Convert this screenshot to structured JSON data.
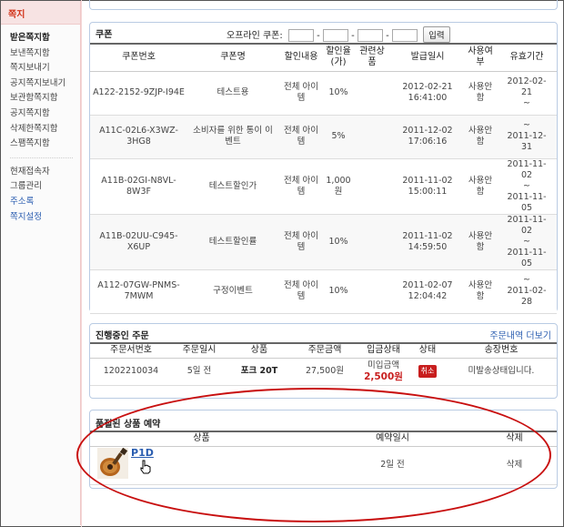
{
  "sidebar": {
    "title": "쪽지",
    "group1": [
      "받은쪽지함",
      "보낸쪽지함",
      "쪽지보내기",
      "공지쪽지보내기",
      "보관함쪽지함",
      "공지쪽지함",
      "삭제한쪽지함",
      "스팸쪽지함"
    ],
    "group2": [
      "현재접속자",
      "그룹관리",
      "주소록",
      "쪽지설정"
    ]
  },
  "coupon": {
    "title": "쿠폰",
    "offline_label": "오프라인 쿠폰:",
    "dash": "-",
    "input_button": "입력",
    "headers": [
      "쿠폰번호",
      "쿠폰명",
      "할인내용",
      "할인율\n(가)",
      "관련상\n품",
      "발급일시",
      "사용여\n부",
      "유효기간"
    ],
    "rows": [
      {
        "no": "A122-2152-9ZJP-I94E",
        "name": "테스트용",
        "content": "전체 아이\n템",
        "rate": "10%",
        "product": "",
        "issued": "2012-02-21\n16:41:00",
        "used": "사용안\n함",
        "valid": "2012-02-\n21\n~"
      },
      {
        "no": "A11C-02L6-X3WZ-\n3HG8",
        "name": "소비자를 위한 통이 이\n벤트",
        "content": "전체 아이\n템",
        "rate": "5%",
        "product": "",
        "issued": "2011-12-02\n17:06:16",
        "used": "사용안\n함",
        "valid": "~\n2011-12-\n31"
      },
      {
        "no": "A11B-02GI-N8VL-\n8W3F",
        "name": "테스트할인가",
        "content": "전체 아이\n템",
        "rate": "1,000원",
        "product": "",
        "issued": "2011-11-02\n15:00:11",
        "used": "사용안\n함",
        "valid": "2011-11-\n02\n~\n2011-11-\n05"
      },
      {
        "no": "A11B-02UU-C945-\nX6UP",
        "name": "테스트할인률",
        "content": "전체 아이\n템",
        "rate": "10%",
        "product": "",
        "issued": "2011-11-02\n14:59:50",
        "used": "사용안\n함",
        "valid": "2011-11-\n02\n~\n2011-11-\n05"
      },
      {
        "no": "A112-07GW-PNMS-\n7MWM",
        "name": "구정이벤트",
        "content": "전체 아이\n템",
        "rate": "10%",
        "product": "",
        "issued": "2011-02-07\n12:04:42",
        "used": "사용안\n함",
        "valid": "~\n2011-02-\n28"
      }
    ]
  },
  "orders": {
    "title": "진행중인 주문",
    "more_link": "주문내역 더보기",
    "headers": [
      "주문서번호",
      "주문일시",
      "상품",
      "주문금액",
      "입금상태",
      "상태",
      "송장번호"
    ],
    "row": {
      "no": "1202210034",
      "date": "5일 전",
      "product": "포크 20T",
      "amount": "27,500원",
      "deposit_label": "미입금액",
      "deposit_amount": "2,500원",
      "status": "취소",
      "invoice": "미발송상태입니다."
    }
  },
  "reservation": {
    "title": "품절된 상품 예약",
    "headers": [
      "상품",
      "예약일시",
      "삭제"
    ],
    "row": {
      "product": "P1D",
      "date": "2일 전",
      "delete": "삭제"
    }
  },
  "colors": {
    "accent_red": "#c81e1e",
    "link_blue": "#2a5db0",
    "panel_border": "#b9cbe3",
    "sidebar_title": "#d2341b"
  },
  "icons": {
    "product_thumb": "guitar-icon",
    "cursor": "hand-cursor-icon"
  }
}
